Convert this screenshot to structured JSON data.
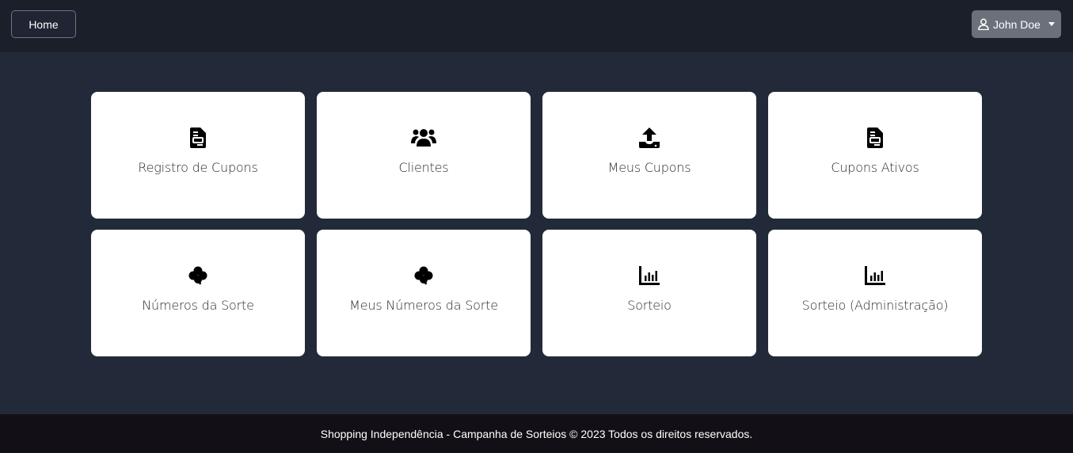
{
  "navbar": {
    "home_label": "Home",
    "user_name": "John Doe"
  },
  "cards": [
    {
      "label": "Registro de Cupons",
      "icon": "file-invoice-icon"
    },
    {
      "label": "Clientes",
      "icon": "users-icon"
    },
    {
      "label": "Meus Cupons",
      "icon": "upload-icon"
    },
    {
      "label": "Cupons Ativos",
      "icon": "file-invoice-icon"
    },
    {
      "label": "Números da Sorte",
      "icon": "clover-icon"
    },
    {
      "label": "Meus Números da Sorte",
      "icon": "clover-icon"
    },
    {
      "label": "Sorteio",
      "icon": "chart-bar-icon"
    },
    {
      "label": "Sorteio (Administração)",
      "icon": "chart-bar-icon"
    }
  ],
  "footer": {
    "text": "Shopping Independência - Campanha de Sorteios © 2023 Todos os direitos reservados."
  },
  "colors": {
    "page_bg": "#222a3a",
    "topbar_bg": "#1a1f2a",
    "footer_bg": "#121016",
    "user_button_bg": "#6b717b",
    "card_bg": "#ffffff"
  }
}
